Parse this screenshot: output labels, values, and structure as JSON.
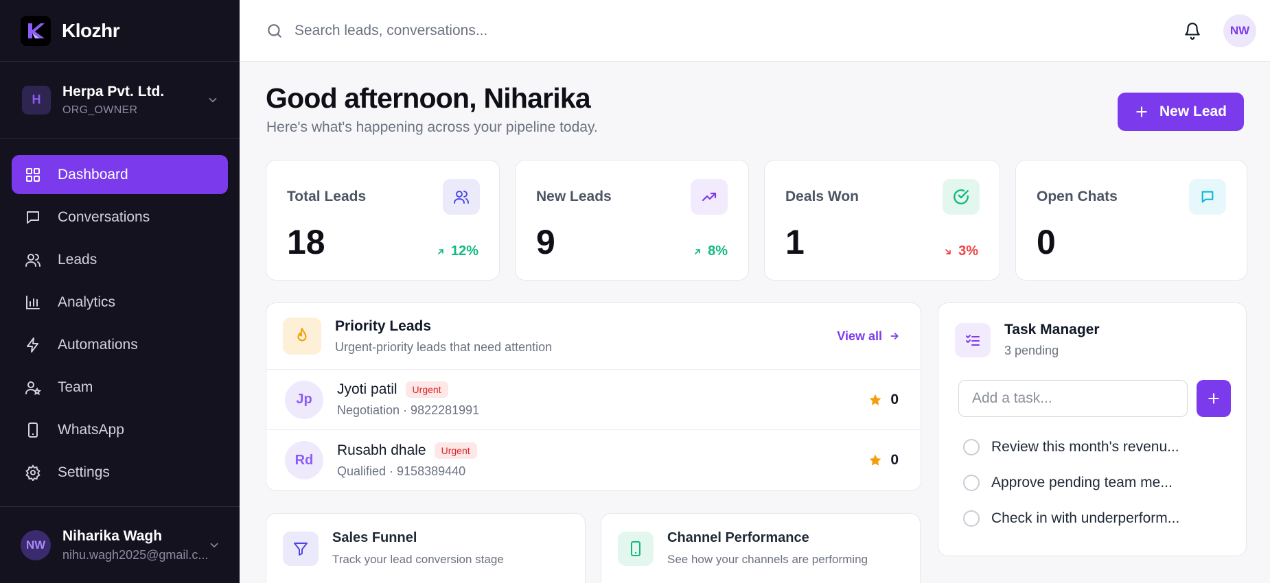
{
  "brand": {
    "name": "Klozhr"
  },
  "org": {
    "initial": "H",
    "name": "Herpa Pvt. Ltd.",
    "role": "ORG_OWNER"
  },
  "nav": [
    {
      "label": "Dashboard",
      "icon": "dashboard-grid-icon",
      "active": true
    },
    {
      "label": "Conversations",
      "icon": "chat-icon"
    },
    {
      "label": "Leads",
      "icon": "users-icon"
    },
    {
      "label": "Analytics",
      "icon": "bar-chart-icon"
    },
    {
      "label": "Automations",
      "icon": "lightning-icon"
    },
    {
      "label": "Team",
      "icon": "team-icon"
    },
    {
      "label": "WhatsApp",
      "icon": "phone-icon"
    },
    {
      "label": "Settings",
      "icon": "gear-icon"
    }
  ],
  "user": {
    "initials": "NW",
    "name": "Niharika Wagh",
    "email": "nihu.wagh2025@gmail.c..."
  },
  "topbar": {
    "search_placeholder": "Search leads, conversations...",
    "avatar_initials": "NW"
  },
  "header": {
    "greeting": "Good afternoon, Niharika",
    "subtitle": "Here's what's happening across your pipeline today.",
    "new_lead_label": "New Lead"
  },
  "stats": [
    {
      "label": "Total Leads",
      "value": "18",
      "trend": "12%",
      "direction": "up",
      "icon": "users-icon",
      "accent": "#4f46e5"
    },
    {
      "label": "New Leads",
      "value": "9",
      "trend": "8%",
      "direction": "up",
      "icon": "trending-up-icon",
      "accent": "#7c3aed"
    },
    {
      "label": "Deals Won",
      "value": "1",
      "trend": "3%",
      "direction": "down",
      "icon": "check-circle-icon",
      "accent": "#10b981"
    },
    {
      "label": "Open Chats",
      "value": "0",
      "trend": "",
      "direction": "",
      "icon": "chat-icon",
      "accent": "#06b6d4"
    }
  ],
  "priority": {
    "title": "Priority Leads",
    "subtitle": "Urgent-priority leads that need attention",
    "view_all": "View all",
    "leads": [
      {
        "initials": "Jp",
        "name": "Jyoti patil",
        "badge": "Urgent",
        "meta": "Negotiation · 9822281991",
        "score": "0"
      },
      {
        "initials": "Rd",
        "name": "Rusabh dhale",
        "badge": "Urgent",
        "meta": "Qualified · 9158389440",
        "score": "0"
      }
    ]
  },
  "tasks": {
    "title": "Task Manager",
    "pending": "3 pending",
    "input_placeholder": "Add a task...",
    "items": [
      "Review this month's revenu...",
      "Approve pending team me...",
      "Check in with underperform..."
    ]
  },
  "funnel": {
    "title": "Sales Funnel",
    "subtitle": "Track your lead conversion stage"
  },
  "channel": {
    "title": "Channel Performance",
    "subtitle": "See how your channels are performing"
  },
  "colors": {
    "accent": "#7c3aed",
    "sidebar_bg": "#14121f",
    "up": "#10b981",
    "down": "#ef4444",
    "star": "#f59e0b"
  }
}
